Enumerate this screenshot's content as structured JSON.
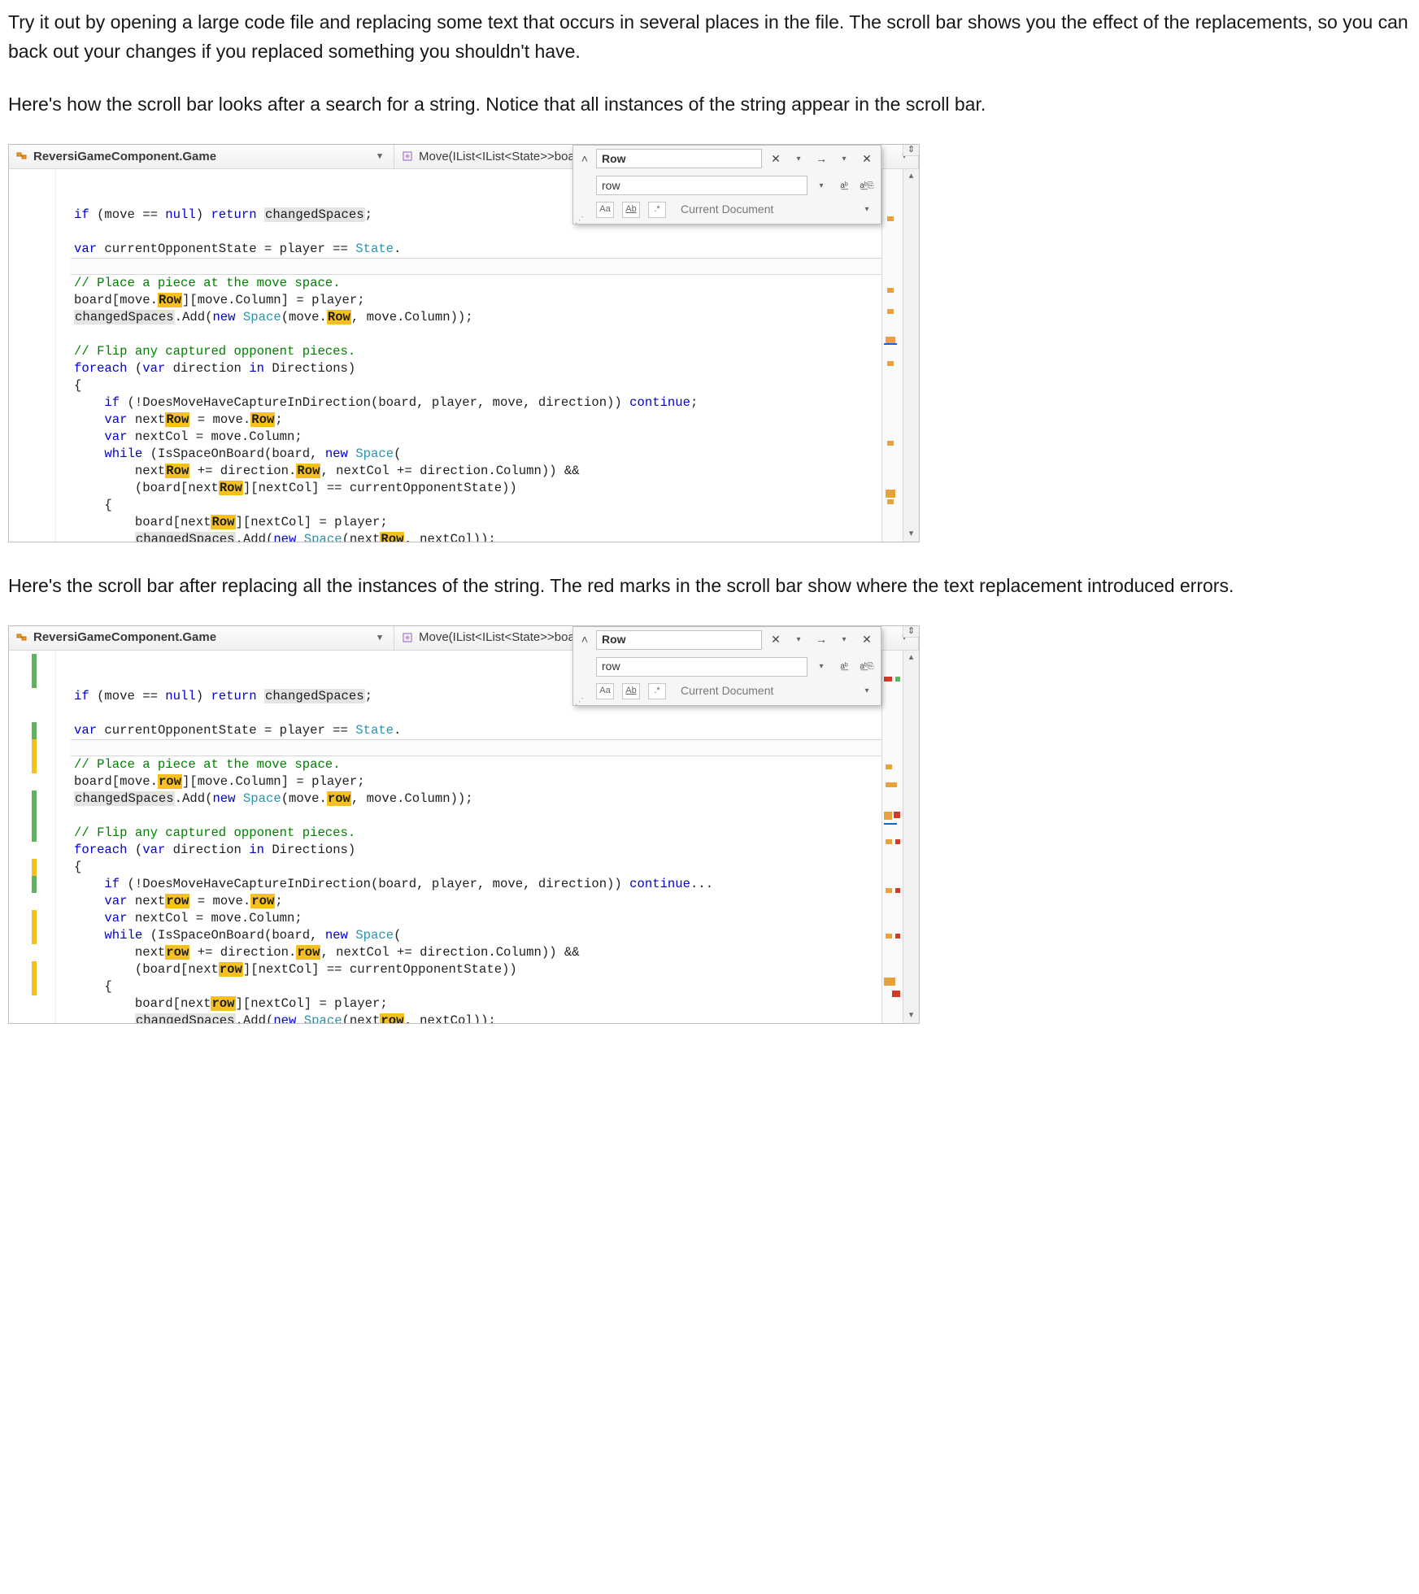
{
  "doc": {
    "p1": "Try it out by opening a large code file and replacing some text that occurs in several places in the file. The scroll bar shows you the effect of the replacements, so you can back out your changes if you replaced something you shouldn't have.",
    "p2": "Here's how the scroll bar looks after a search for a string. Notice that all instances of the string appear in the scroll bar.",
    "p3": "Here's the scroll bar after replacing all the instances of the string. The red marks in the scroll bar show where the text replacement introduced errors."
  },
  "navbar": {
    "class_label": "ReversiGameComponent.Game",
    "method_label": "Move(IList<IList<State>>board, Space move, State pl…"
  },
  "find": {
    "search_value": "Row",
    "replace_value": "row",
    "scope": "Current Document",
    "opt_case": "Aa",
    "opt_word": "Ab",
    "opt_regex": ".*"
  },
  "code1": {
    "l1a": "if",
    "l1b": " (move == ",
    "l1c": "null",
    "l1d": ") ",
    "l1e": "return",
    "l1f": " ",
    "l1g": "changedSpaces",
    "l1h": ";",
    "l3a": "var",
    "l3b": " currentOpponentState = player == ",
    "l3c": "State",
    "l3d": ".",
    "l5": "// Place a piece at the move space.",
    "l6a": "board[move.",
    "l6b": "Row",
    "l6c": "][move.Column] = player;",
    "l7a": "changedSpaces",
    "l7b": ".Add(",
    "l7c": "new",
    "l7d": " ",
    "l7e": "Space",
    "l7f": "(move.",
    "l7g": "Row",
    "l7h": ", move.Column));",
    "l9": "// Flip any captured opponent pieces.",
    "l10a": "foreach",
    "l10b": " (",
    "l10c": "var",
    "l10d": " direction ",
    "l10e": "in",
    "l10f": " Directions)",
    "l11": "{",
    "l12a": "    if",
    "l12b": " (!DoesMoveHaveCaptureInDirection(board, player, move, direction)) ",
    "l12c": "continue",
    "l12d": ";",
    "l13a": "    var",
    "l13b": " next",
    "l13c": "Row",
    "l13d": " = move.",
    "l13e": "Row",
    "l13f": ";",
    "l14a": "    var",
    "l14b": " nextCol = move.Column;",
    "l15a": "    while",
    "l15b": " (IsSpaceOnBoard(board, ",
    "l15c": "new",
    "l15d": " ",
    "l15e": "Space",
    "l15f": "(",
    "l16a": "        next",
    "l16b": "Row",
    "l16c": " += direction.",
    "l16d": "Row",
    "l16e": ", nextCol += direction.Column)) &&",
    "l17a": "        (board[next",
    "l17b": "Row",
    "l17c": "][nextCol] == currentOpponentState))",
    "l18": "    {",
    "l19a": "        board[next",
    "l19b": "Row",
    "l19c": "][nextCol] = player;",
    "l20a": "        ",
    "l20b": "changedSpaces",
    "l20c": ".Add(",
    "l20d": "new",
    "l20e": " ",
    "l20f": "Space",
    "l20g": "(next",
    "l20h": "Row",
    "l20i": ", nextCol));",
    "l21": "    }",
    "l22": "}"
  },
  "code2": {
    "l1a": "if",
    "l1b": " (move == ",
    "l1c": "null",
    "l1d": ") ",
    "l1e": "return",
    "l1f": " ",
    "l1g": "changedSpaces",
    "l1h": ";",
    "l3a": "var",
    "l3b": " currentOpponentState = player == ",
    "l3c": "State",
    "l3d": ".",
    "l5": "// Place a piece at the move space.",
    "l6a": "board[move.",
    "l6b": "row",
    "l6c": "][move.Column] = player;",
    "l7a": "changedSpaces",
    "l7b": ".Add(",
    "l7c": "new",
    "l7d": " ",
    "l7e": "Space",
    "l7f": "(move.",
    "l7g": "row",
    "l7h": ", move.Column));",
    "l9": "// Flip any captured opponent pieces.",
    "l10a": "foreach",
    "l10b": " (",
    "l10c": "var",
    "l10d": " direction ",
    "l10e": "in",
    "l10f": " Directions)",
    "l11": "{",
    "l12a": "    if",
    "l12b": " (!DoesMoveHaveCaptureInDirection(board, player, move, direction)) ",
    "l12c": "continue",
    "l12d": "...",
    "l13a": "    var",
    "l13b": " next",
    "l13c": "row",
    "l13d": " = move.",
    "l13e": "row",
    "l13f": ";",
    "l14a": "    var",
    "l14b": " nextCol = move.Column;",
    "l15a": "    while",
    "l15b": " (IsSpaceOnBoard(board, ",
    "l15c": "new",
    "l15d": " ",
    "l15e": "Space",
    "l15f": "(",
    "l16a": "        next",
    "l16b": "row",
    "l16c": " += direction.",
    "l16d": "row",
    "l16e": ", nextCol += direction.Column)) &&",
    "l17a": "        (board[next",
    "l17b": "row",
    "l17c": "][nextCol] == currentOpponentState))",
    "l18": "    {",
    "l19a": "        board[next",
    "l19b": "row",
    "l19c": "][nextCol] = player;",
    "l20a": "        ",
    "l20b": "changedSpaces",
    "l20c": ".Add(",
    "l20d": "new",
    "l20e": " ",
    "l20f": "Space",
    "l20g": "(next",
    "l20h": "row",
    "l20i": ", nextCol));",
    "l21": "    }",
    "l22": "}"
  }
}
